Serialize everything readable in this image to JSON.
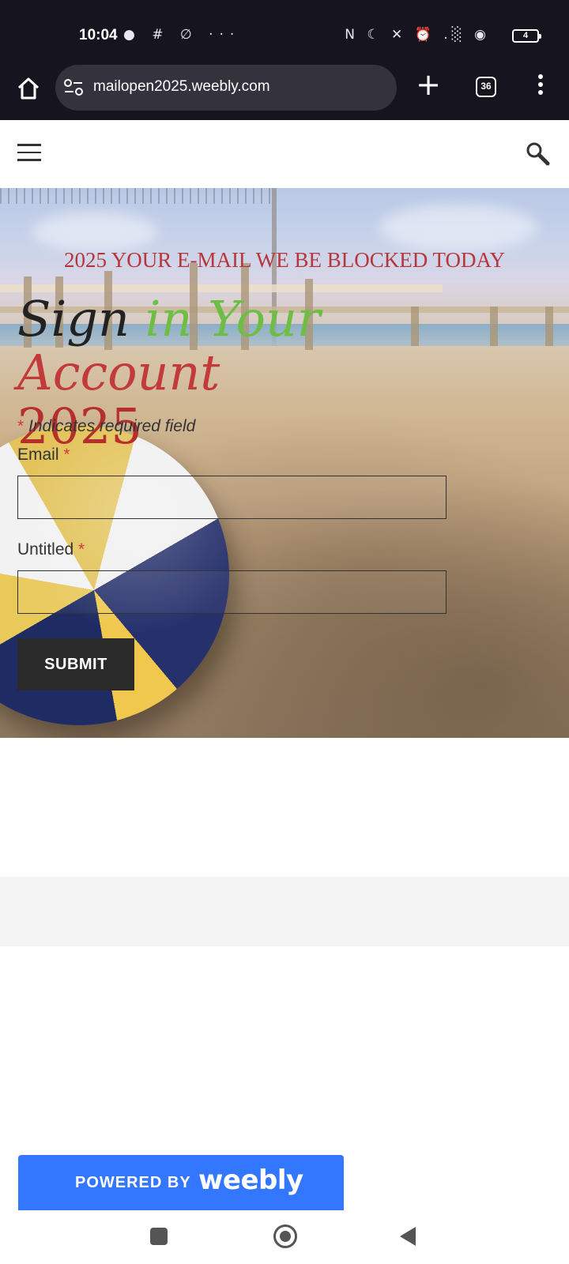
{
  "status_bar": {
    "time": "10:04",
    "left_icons": "● # ∅ ···",
    "right_icons": "N ☾ ✕ ⏰ .░ ◉",
    "battery": "4"
  },
  "browser": {
    "url": "mailopen2025.weebly.com",
    "tab_count": "36",
    "new_tab_symbol": "+"
  },
  "hero": {
    "subtitle": "2025 YOUR E-MAIL WE BE BLOCKED TODAY",
    "title_sign": "Sign ",
    "title_mid": "in Your ",
    "title_account": "Account",
    "title_year": "2025",
    "title_colors": {
      "sign": "#222222",
      "mid": "#6ebd45",
      "account": "#c23a3a"
    }
  },
  "form": {
    "required_star": "*",
    "required_note": "Indicates required field",
    "email_label": "Email",
    "untitled_label": "Untitled",
    "email_value": "",
    "untitled_value": "",
    "submit_label": "SUBMIT"
  },
  "footer": {
    "powered_by": "POWERED BY",
    "brand": "weebly",
    "brand_color": "#3376ff"
  },
  "icons": [
    "home-icon",
    "site-settings-icon",
    "plus-icon",
    "tabs-icon",
    "more-vertical-icon",
    "hamburger-menu-icon",
    "search-icon",
    "recents-icon",
    "home-nav-icon",
    "back-icon"
  ]
}
